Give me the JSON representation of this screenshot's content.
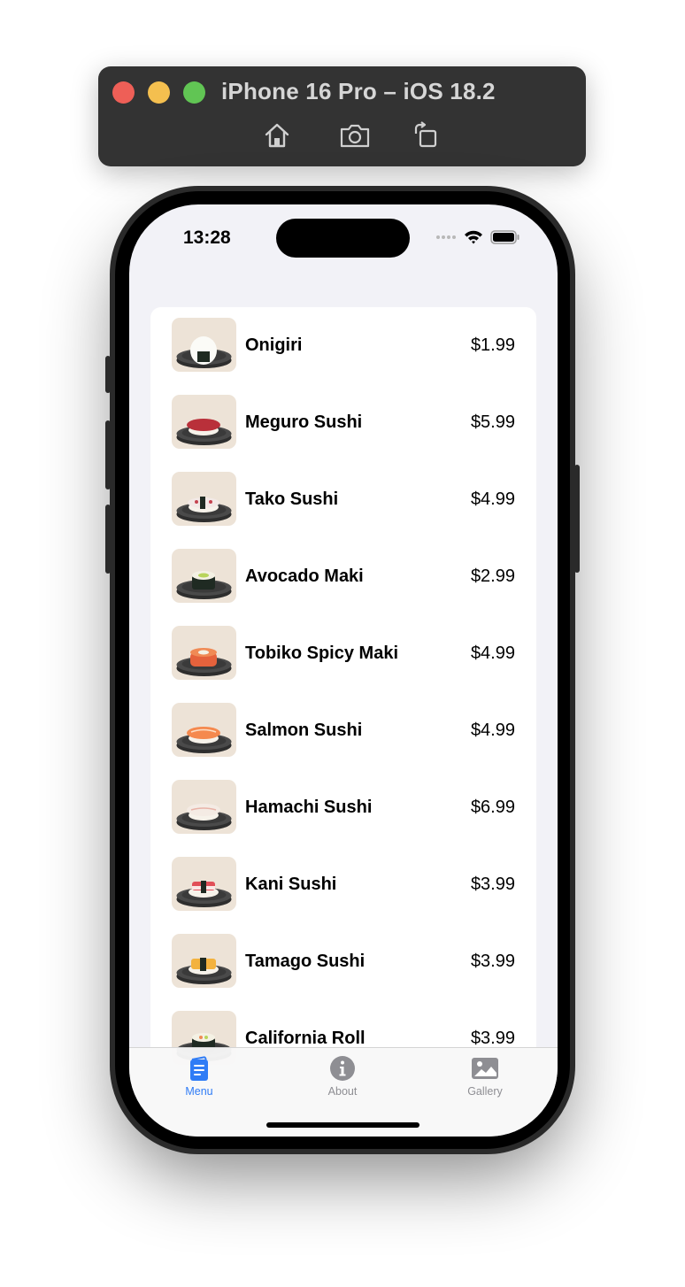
{
  "simulator": {
    "title": "iPhone 16 Pro – iOS 18.2",
    "buttons": [
      {
        "icon": "home-icon"
      },
      {
        "icon": "camera-icon"
      },
      {
        "icon": "rotate-icon"
      }
    ]
  },
  "status_bar": {
    "time": "13:28",
    "icons": [
      "signal-dots-icon",
      "wifi-icon",
      "battery-icon"
    ]
  },
  "menu": {
    "items": [
      {
        "name": "Onigiri",
        "price": "$1.99",
        "icon": "onigiri-icon"
      },
      {
        "name": "Meguro Sushi",
        "price": "$5.99",
        "icon": "meguro-sushi-icon"
      },
      {
        "name": "Tako Sushi",
        "price": "$4.99",
        "icon": "tako-sushi-icon"
      },
      {
        "name": "Avocado Maki",
        "price": "$2.99",
        "icon": "avocado-maki-icon"
      },
      {
        "name": "Tobiko Spicy Maki",
        "price": "$4.99",
        "icon": "tobiko-maki-icon"
      },
      {
        "name": "Salmon Sushi",
        "price": "$4.99",
        "icon": "salmon-sushi-icon"
      },
      {
        "name": "Hamachi Sushi",
        "price": "$6.99",
        "icon": "hamachi-sushi-icon"
      },
      {
        "name": "Kani Sushi",
        "price": "$3.99",
        "icon": "kani-sushi-icon"
      },
      {
        "name": "Tamago Sushi",
        "price": "$3.99",
        "icon": "tamago-sushi-icon"
      },
      {
        "name": "California Roll",
        "price": "$3.99",
        "icon": "california-roll-icon"
      }
    ]
  },
  "tab_bar": {
    "tabs": [
      {
        "label": "Menu",
        "icon": "menu-book-icon",
        "selected": true
      },
      {
        "label": "About",
        "icon": "info-icon",
        "selected": false
      },
      {
        "label": "Gallery",
        "icon": "photo-icon",
        "selected": false
      }
    ],
    "active_color": "#2f7cf6",
    "inactive_color": "#8e8e93"
  }
}
